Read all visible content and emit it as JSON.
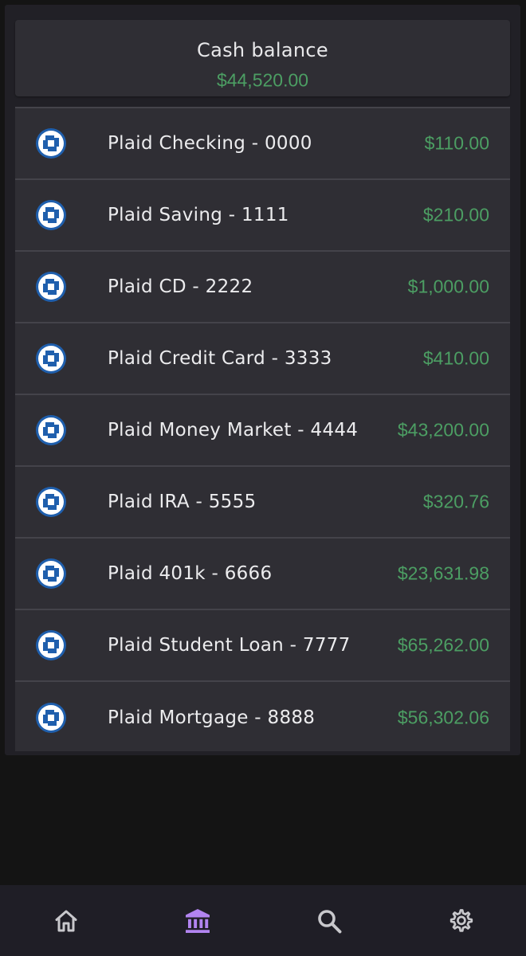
{
  "summary": {
    "title": "Cash balance",
    "value": "$44,520.00"
  },
  "accounts": [
    {
      "label": "Plaid Checking - 0000",
      "amount": "$110.00",
      "icon": "chase-bank-icon"
    },
    {
      "label": "Plaid Saving - 1111",
      "amount": "$210.00",
      "icon": "chase-bank-icon"
    },
    {
      "label": "Plaid CD - 2222",
      "amount": "$1,000.00",
      "icon": "chase-bank-icon"
    },
    {
      "label": "Plaid Credit Card - 3333",
      "amount": "$410.00",
      "icon": "chase-bank-icon"
    },
    {
      "label": "Plaid Money Market - 4444",
      "amount": "$43,200.00",
      "icon": "chase-bank-icon"
    },
    {
      "label": "Plaid IRA - 5555",
      "amount": "$320.76",
      "icon": "chase-bank-icon"
    },
    {
      "label": "Plaid 401k - 6666",
      "amount": "$23,631.98",
      "icon": "chase-bank-icon"
    },
    {
      "label": "Plaid Student Loan - 7777",
      "amount": "$65,262.00",
      "icon": "chase-bank-icon"
    },
    {
      "label": "Plaid Mortgage - 8888",
      "amount": "$56,302.06",
      "icon": "chase-bank-icon"
    }
  ],
  "nav": [
    {
      "icon": "home-icon",
      "active": false
    },
    {
      "icon": "bank-icon",
      "active": true
    },
    {
      "icon": "search-icon",
      "active": false
    },
    {
      "icon": "settings-gear-icon",
      "active": false
    }
  ],
  "colors": {
    "background": "#141414",
    "card": "#2f2e34",
    "positive": "#4c9e63",
    "nav_active": "#b284f0",
    "nav_inactive": "#c8c8cc",
    "bank_blue": "#1f5fad"
  }
}
